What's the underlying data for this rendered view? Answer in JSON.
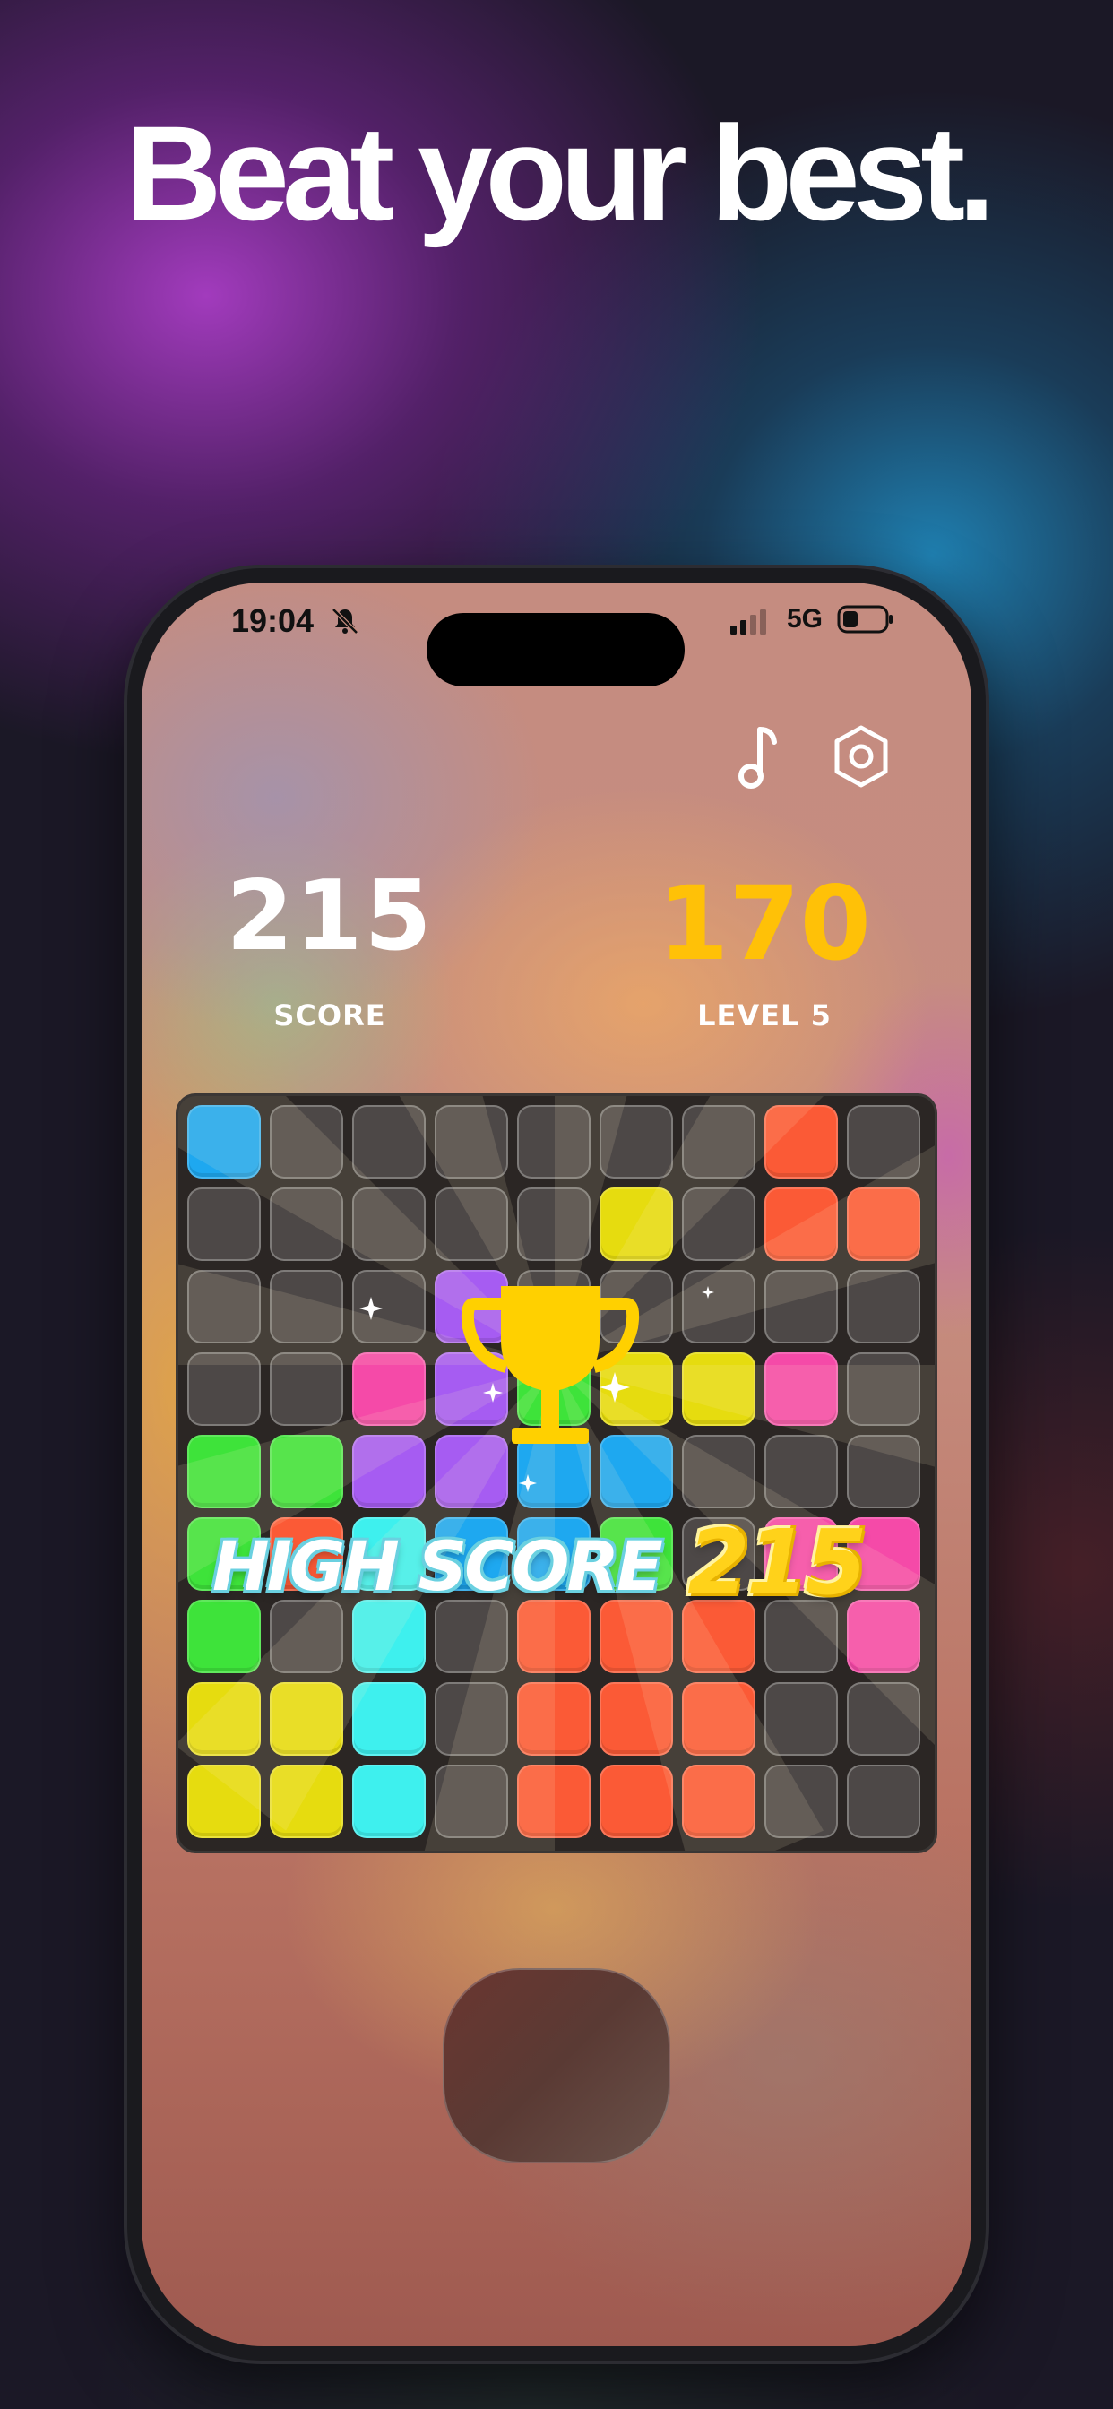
{
  "headline": "Beat your best.",
  "status_bar": {
    "time": "19:04",
    "network": "5G",
    "icons": [
      "bell-slash-icon",
      "signal-icon",
      "battery-icon"
    ]
  },
  "toolbar": {
    "icons": [
      "music-note-icon",
      "settings-gear-icon"
    ]
  },
  "stats": {
    "score_value": "215",
    "score_label": "SCORE",
    "level_target": "170",
    "level_label": "LEVEL 5"
  },
  "colors": {
    "blue": "#1ea8f0",
    "orange": "#fb5a36",
    "yellow": "#e6dc0f",
    "pink": "#f54aa8",
    "green": "#3ee33a",
    "purple": "#a65cf2",
    "cyan": "#3ef0ee",
    "gold": "#ffc107"
  },
  "board": {
    "rows": 9,
    "cols": 9,
    "grid": [
      [
        "B",
        ".",
        ".",
        ".",
        ".",
        ".",
        ".",
        "O",
        "."
      ],
      [
        ".",
        ".",
        ".",
        ".",
        ".",
        "Y",
        ".",
        "O",
        "O"
      ],
      [
        ".",
        ".",
        ".",
        "P",
        ".",
        ".",
        ".",
        ".",
        "."
      ],
      [
        ".",
        ".",
        "K",
        "P",
        "G",
        "Y",
        "Y",
        "K",
        "."
      ],
      [
        "G",
        "G",
        "P",
        "P",
        "B",
        "B",
        ".",
        ".",
        "."
      ],
      [
        "G",
        "O",
        "C",
        "B",
        "B",
        "G",
        ".",
        "K",
        "K"
      ],
      [
        "G",
        ".",
        "C",
        ".",
        "O",
        "O",
        "O",
        ".",
        "K"
      ],
      [
        "Y",
        "Y",
        "C",
        ".",
        "O",
        "O",
        "O",
        ".",
        "."
      ],
      [
        "Y",
        "Y",
        "C",
        ".",
        "O",
        "O",
        "O",
        ".",
        "."
      ]
    ],
    "legend": {
      "B": "blue",
      "O": "orange",
      "Y": "yellow",
      "K": "pink",
      "G": "green",
      "P": "purple",
      "C": "cyan"
    }
  },
  "high_score": {
    "label": "HIGH SCORE",
    "value": "215",
    "icon": "trophy-icon"
  },
  "piece_tray": {
    "icon": "empty-piece-slot"
  }
}
